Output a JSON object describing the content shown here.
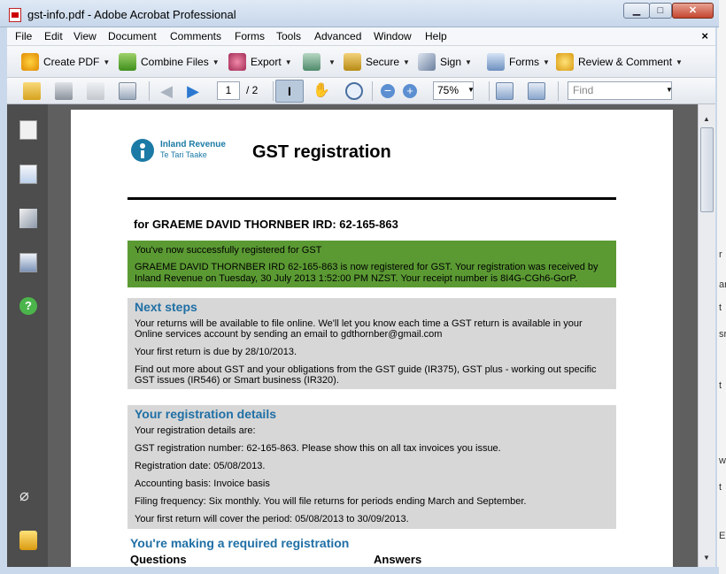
{
  "window": {
    "title": "gst-info.pdf - Adobe Acrobat Professional",
    "minimize": "▁",
    "maximize": "□",
    "close": "✕"
  },
  "menu": [
    "File",
    "Edit",
    "View",
    "Document",
    "Comments",
    "Forms",
    "Tools",
    "Advanced",
    "Window",
    "Help"
  ],
  "menu_close": "×",
  "toolbar": {
    "create_pdf": "Create PDF",
    "combine_files": "Combine Files",
    "export": "Export",
    "secure": "Secure",
    "sign": "Sign",
    "forms": "Forms",
    "review_comment": "Review & Comment"
  },
  "nav": {
    "page_current": "1",
    "page_total": "/ 2",
    "zoom": "75%",
    "find_placeholder": "Find"
  },
  "doc": {
    "org_name": "Inland Revenue",
    "org_maori": "Te Tari Taake",
    "title": "GST registration",
    "for_line": "for GRAEME DAVID THORNBER IRD: 62-165-863",
    "success_line1": "You've now successfully registered for GST",
    "success_line2": "GRAEME DAVID THORNBER IRD 62-165-863 is now registered for GST.  Your registration was received by Inland Revenue on Tuesday, 30 July 2013 1:52:00 PM NZST. Your receipt number is 8I4G-CGh6-GorP.",
    "next_steps": {
      "heading": "Next steps",
      "p1": "Your returns will be available to file online. We'll let you know each time a GST return is available in your Online services account by sending an email to gdthornber@gmail.com",
      "p2": "Your first return is due by 28/10/2013.",
      "p3": "Find out more about GST and your obligations from the GST guide (IR375), GST plus - working out specific GST issues (IR546) or Smart business (IR320)."
    },
    "details": {
      "heading": "Your registration details",
      "l1": "Your registration details are:",
      "l2": "GST registration number: 62-165-863. Please show this on all tax invoices you issue.",
      "l3": "Registration date: 05/08/2013.",
      "l4": "Accounting basis: Invoice basis",
      "l5": "Filing frequency: Six monthly. You will file returns for periods ending March and September.",
      "l6": "Your first return will cover the period: 05/08/2013 to 30/09/2013."
    },
    "required_heading": "You're making a required registration",
    "col_questions": "Questions",
    "col_answers": "Answers"
  },
  "bg_letters": [
    "r",
    "ar",
    "t",
    "sr",
    "t",
    "w",
    "t",
    "E"
  ],
  "colors": {
    "green_banner": "#5b9a33",
    "grey_box": "#d7d7d7",
    "heading_blue": "#1f6fa5",
    "nav_pane": "#4d4d4d"
  }
}
